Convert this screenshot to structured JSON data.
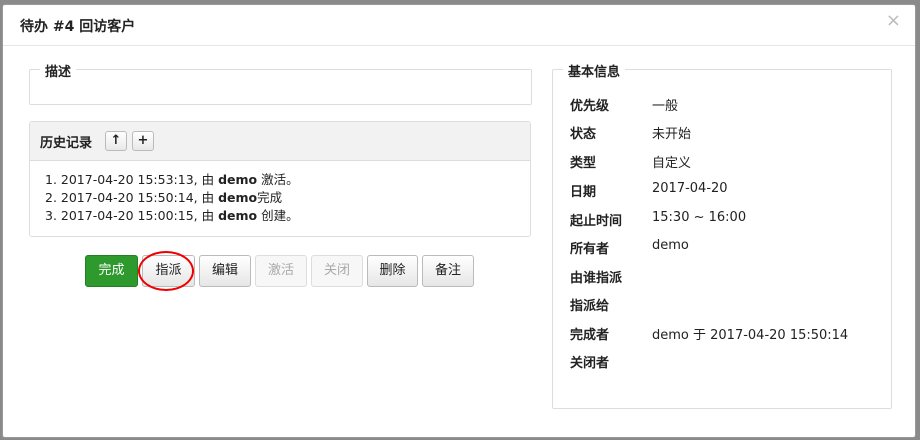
{
  "modal": {
    "title": "待办 #4 回访客户",
    "close_symbol": "×"
  },
  "description": {
    "legend": "描述",
    "content": ""
  },
  "history": {
    "title": "历史记录",
    "up_button_icon": "arrow-up-icon",
    "add_button_icon": "plus-icon",
    "entries": [
      {
        "prefix": "1. 2017-04-20 15:53:13, 由 ",
        "user": "demo",
        "suffix": " 激活。"
      },
      {
        "prefix": "2. 2017-04-20 15:50:14, 由 ",
        "user": "demo",
        "suffix": "完成"
      },
      {
        "prefix": "3. 2017-04-20 15:00:15, 由 ",
        "user": "demo",
        "suffix": " 创建。"
      }
    ]
  },
  "actions": {
    "finish": "完成",
    "assign": "指派",
    "edit": "编辑",
    "activate": "激活",
    "close": "关闭",
    "delete": "删除",
    "note": "备注"
  },
  "basic_info": {
    "legend": "基本信息",
    "rows": [
      {
        "label": "优先级",
        "value": "一般"
      },
      {
        "label": "状态",
        "value": "未开始"
      },
      {
        "label": "类型",
        "value": "自定义"
      },
      {
        "label": "日期",
        "value": "2017-04-20"
      },
      {
        "label": "起止时间",
        "value": "15:30 ~ 16:00"
      },
      {
        "label": "所有者",
        "value": "demo"
      },
      {
        "label": "由谁指派",
        "value": ""
      },
      {
        "label": "指派给",
        "value": ""
      },
      {
        "label": "完成者",
        "value": "demo 于 2017-04-20 15:50:14"
      },
      {
        "label": "关闭者",
        "value": ""
      }
    ]
  },
  "colors": {
    "primary_button": "#2e9a2e",
    "annotation_circle": "#e00000"
  }
}
